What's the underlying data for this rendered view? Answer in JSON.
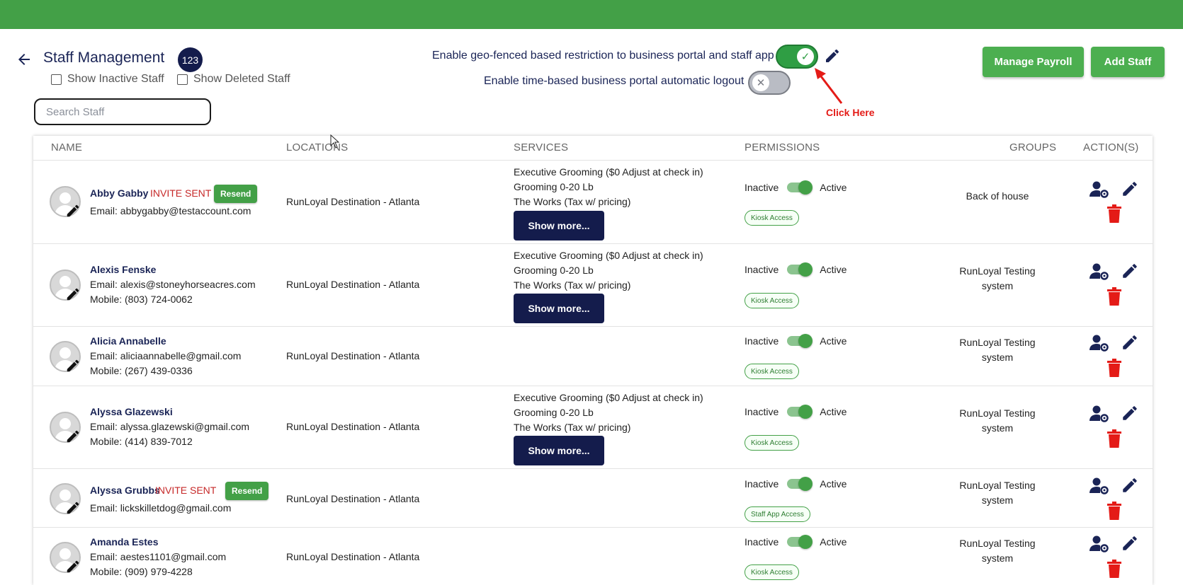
{
  "header": {
    "title": "Staff Management",
    "staff_count": "123",
    "show_inactive_label": "Show Inactive Staff",
    "show_deleted_label": "Show Deleted Staff",
    "search_placeholder": "Search Staff",
    "geo_toggle_label": "Enable geo-fenced based restriction to business portal and staff app",
    "logout_toggle_label": "Enable time-based business portal automatic logout",
    "annotation": "Click Here",
    "manage_payroll_label": "Manage Payroll",
    "add_staff_label": "Add Staff"
  },
  "colors": {
    "topbar": "#43a047",
    "navy": "#141c4c",
    "accent_green": "#4caf50",
    "danger": "#e41b17"
  },
  "table": {
    "columns": [
      "NAME",
      "LOCATIONS",
      "SERVICES",
      "PERMISSIONS",
      "GROUPS",
      "ACTION(S)"
    ],
    "inactive_label": "Inactive",
    "active_label": "Active",
    "show_more_label": "Show more...",
    "invite_label": "INVITE SENT",
    "resend_label": "Resend",
    "rows": [
      {
        "name": "Abby Gabby",
        "email": "Email: abbygabby@testaccount.com",
        "location": "RunLoyal Destination - Atlanta",
        "services": [
          "Executive Grooming ($0 Adjust at check in)",
          "Grooming 0-20 Lb",
          "The Works (Tax w/ pricing)"
        ],
        "permission_tag": "Kiosk Access",
        "group_line1": "Back of house"
      },
      {
        "name": "Alexis Fenske",
        "email": "Email: alexis@stoneyhorseacres.com",
        "mobile": "Mobile: (803) 724-0062",
        "location": "RunLoyal Destination - Atlanta",
        "services": [
          "Executive Grooming ($0 Adjust at check in)",
          "Grooming 0-20 Lb",
          "The Works (Tax w/ pricing)"
        ],
        "permission_tag": "Kiosk Access",
        "group_line1": "RunLoyal Testing",
        "group_line2": "system"
      },
      {
        "name": "Alicia Annabelle",
        "email": "Email: aliciaannabelle@gmail.com",
        "mobile": "Mobile: (267) 439-0336",
        "location": "RunLoyal Destination - Atlanta",
        "permission_tag": "Kiosk Access",
        "group_line1": "RunLoyal Testing",
        "group_line2": "system"
      },
      {
        "name": "Alyssa Glazewski",
        "email": "Email: alyssa.glazewski@gmail.com",
        "mobile": "Mobile: (414) 839-7012",
        "location": "RunLoyal Destination - Atlanta",
        "services": [
          "Executive Grooming ($0 Adjust at check in)",
          "Grooming 0-20 Lb",
          "The Works (Tax w/ pricing)"
        ],
        "permission_tag": "Kiosk Access",
        "group_line1": "RunLoyal Testing",
        "group_line2": "system"
      },
      {
        "name": "Alyssa Grubbs",
        "email": "Email: lickskilletdog@gmail.com",
        "location": "RunLoyal Destination - Atlanta",
        "permission_tag": "Staff App Access",
        "group_line1": "RunLoyal Testing",
        "group_line2": "system"
      },
      {
        "name": "Amanda Estes",
        "email": "Email: aestes1101@gmail.com",
        "mobile": "Mobile: (909) 979-4228",
        "location": "RunLoyal Destination - Atlanta",
        "permission_tag": "Kiosk Access",
        "group_line1": "RunLoyal Testing",
        "group_line2": "system"
      }
    ]
  }
}
